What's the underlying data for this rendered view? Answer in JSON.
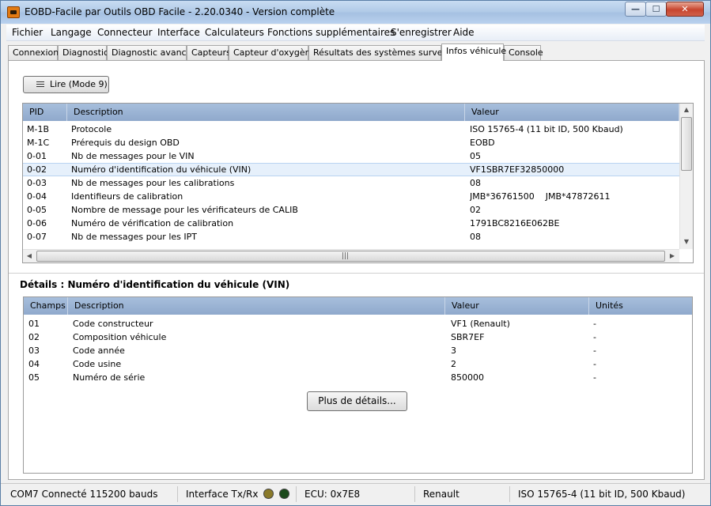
{
  "window": {
    "title": "EOBD-Facile par Outils OBD Facile - 2.20.0340 - Version complète"
  },
  "window_buttons": {
    "minimize": "—",
    "maximize": "☐",
    "close": "✕"
  },
  "menu": [
    "Fichier",
    "Langage",
    "Connecteur",
    "Interface",
    "Calculateurs",
    "Fonctions supplémentaires",
    "S'enregistrer",
    "Aide"
  ],
  "tabs": [
    "Connexion",
    "Diagnostic",
    "Diagnostic avancé",
    "Capteurs",
    "Capteur d'oxygène",
    "Résultats des systèmes surveillés",
    "Infos véhicule",
    "Console"
  ],
  "active_tab": "Infos véhicule",
  "read_button": {
    "label": "Lire (Mode 9)",
    "icon": "list-icon"
  },
  "main_table": {
    "headers": [
      "PID",
      "Description",
      "Valeur"
    ],
    "rows": [
      [
        "M-1B",
        "Protocole",
        "ISO 15765-4 (11 bit ID, 500 Kbaud)"
      ],
      [
        "M-1C",
        "Prérequis du design OBD",
        "EOBD"
      ],
      [
        "0-01",
        "Nb de messages pour le VIN",
        "05"
      ],
      [
        "0-02",
        "Numéro d'identification du véhicule (VIN)",
        "VF1SBR7EF32850000"
      ],
      [
        "0-03",
        "Nb de messages pour les calibrations",
        "08"
      ],
      [
        "0-04",
        "Identifieurs de calibration",
        "JMB*36761500    JMB*47872611"
      ],
      [
        "0-05",
        "Nombre de message pour les vérificateurs de CALIB",
        "02"
      ],
      [
        "0-06",
        "Numéro de vérification de calibration",
        "1791BC8216E062BE"
      ],
      [
        "0-07",
        "Nb de messages pour les IPT",
        "08"
      ]
    ],
    "selected_row": 3
  },
  "details": {
    "title": "Détails : Numéro d'identification du véhicule (VIN)",
    "headers": [
      "Champs",
      "Description",
      "Valeur",
      "Unités"
    ],
    "rows": [
      [
        "01",
        "Code constructeur",
        "VF1 (Renault)",
        "-"
      ],
      [
        "02",
        "Composition véhicule",
        "SBR7EF",
        "-"
      ],
      [
        "03",
        "Code année",
        "3",
        "-"
      ],
      [
        "04",
        "Code usine",
        "2",
        "-"
      ],
      [
        "05",
        "Numéro de série",
        "850000",
        "-"
      ]
    ],
    "more_button": "Plus de détails..."
  },
  "statusbar": {
    "connection": "COM7 Connecté 115200 bauds",
    "interface": "Interface Tx/Rx",
    "ecu": "ECU: 0x7E8",
    "make": "Renault",
    "protocol": "ISO 15765-4 (11 bit ID, 500 Kbaud)"
  },
  "colors": {
    "header_bg": "#9fb8d8",
    "selected_row_bg": "#e6f0fb",
    "led_tx": "#8a7a2a",
    "led_rx": "#1c4a1c"
  }
}
